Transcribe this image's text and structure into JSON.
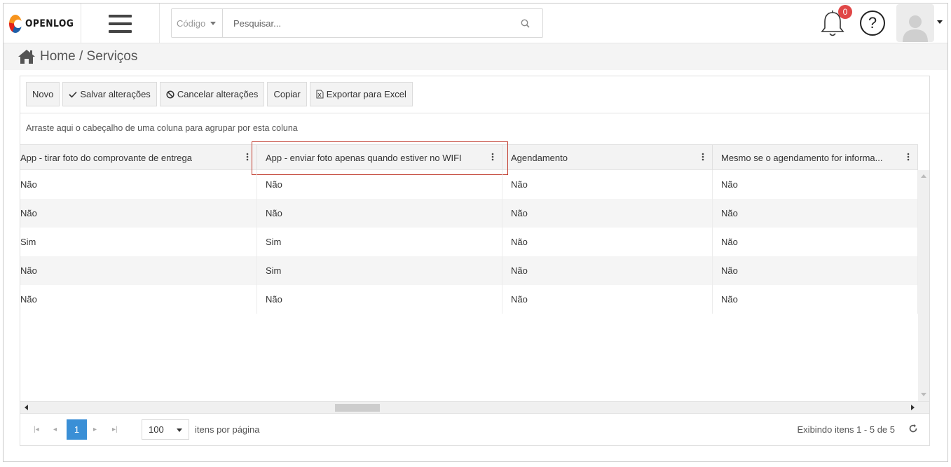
{
  "app": {
    "logo_text": "OPENLOG"
  },
  "search": {
    "code_label": "Código",
    "placeholder": "Pesquisar..."
  },
  "notifications": {
    "count": "0"
  },
  "help": {
    "symbol": "?"
  },
  "breadcrumb": {
    "text": "Home / Serviços"
  },
  "toolbar": {
    "new_label": "Novo",
    "save_label": "Salvar alterações",
    "cancel_label": "Cancelar alterações",
    "copy_label": "Copiar",
    "export_label": "Exportar para Excel"
  },
  "grid": {
    "group_hint": "Arraste aqui o cabeçalho de uma coluna para agrupar por esta coluna",
    "columns": [
      "App - tirar foto do comprovante de entrega",
      "App - enviar foto apenas quando estiver no WIFI",
      "Agendamento",
      "Mesmo se o agendamento for informa..."
    ],
    "rows": [
      [
        "Não",
        "Não",
        "Não",
        "Não"
      ],
      [
        "Não",
        "Não",
        "Não",
        "Não"
      ],
      [
        "Sim",
        "Sim",
        "Não",
        "Não"
      ],
      [
        "Não",
        "Sim",
        "Não",
        "Não"
      ],
      [
        "Não",
        "Não",
        "Não",
        "Não"
      ]
    ]
  },
  "pager": {
    "current_page": "1",
    "page_size": "100",
    "page_size_label": "itens por página",
    "info": "Exibindo itens 1 - 5 de 5"
  },
  "colors": {
    "accent": "#3a8fd6",
    "badge": "#e04646",
    "highlight": "#c0392b"
  },
  "icons": [
    "home-icon",
    "search-icon",
    "bell-icon",
    "help-icon",
    "check-icon",
    "cancel-icon",
    "excel-icon",
    "kebab-icon",
    "refresh-icon"
  ]
}
